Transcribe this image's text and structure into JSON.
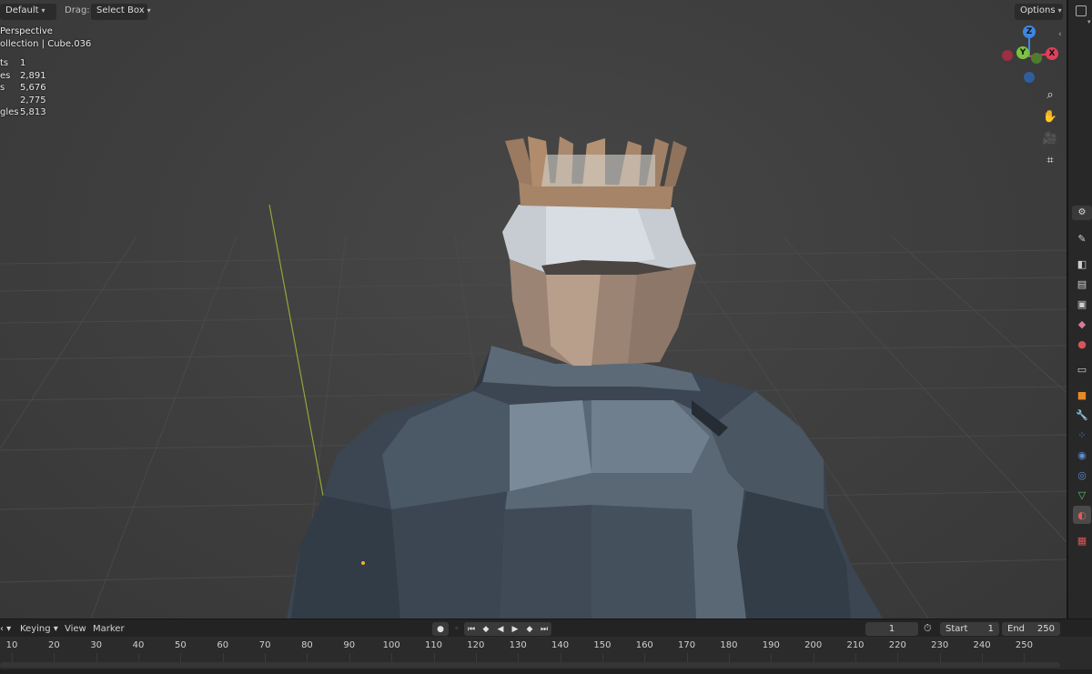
{
  "header": {
    "orientation_value": "Default",
    "drag_label": "Drag:",
    "drag_value": "Select Box",
    "options_label": "Options"
  },
  "overlay": {
    "view_name": "Perspective",
    "collection_line": "ollection | Cube.036"
  },
  "stats": [
    {
      "label": "ts",
      "value": "1"
    },
    {
      "label": "es",
      "value": "2,891"
    },
    {
      "label": "s",
      "value": "5,676"
    },
    {
      "label": "",
      "value": "2,775"
    },
    {
      "label": "gles",
      "value": "5,813"
    }
  ],
  "gizmo": {
    "z_label": "Z",
    "y_label": "Y",
    "x_label": "X",
    "colors": {
      "x": "#e0405a",
      "y": "#7cc242",
      "z": "#3f86e0"
    }
  },
  "nav_buttons": [
    "zoom-icon",
    "hand-pan-icon",
    "camera-icon",
    "grid-ortho-icon"
  ],
  "properties_tabs": [
    {
      "name": "tool-icon",
      "glyph": "✎",
      "color": "#cfcfcf"
    },
    {
      "name": "render-icon",
      "glyph": "◧",
      "color": "#cfcfcf"
    },
    {
      "name": "output-icon",
      "glyph": "▤",
      "color": "#cfcfcf"
    },
    {
      "name": "view-layer-icon",
      "glyph": "▣",
      "color": "#cfcfcf"
    },
    {
      "name": "scene-icon",
      "glyph": "◆",
      "color": "#d77aa0"
    },
    {
      "name": "world-icon",
      "glyph": "●",
      "color": "#d9545a"
    },
    {
      "name": "collection-icon",
      "glyph": "▭",
      "color": "#cfcfcf"
    },
    {
      "name": "object-icon",
      "glyph": "■",
      "color": "#e58a26"
    },
    {
      "name": "modifier-icon",
      "glyph": "🔧",
      "color": "#5b8fd6"
    },
    {
      "name": "particles-icon",
      "glyph": "⁘",
      "color": "#5b8fd6"
    },
    {
      "name": "physics-icon",
      "glyph": "◉",
      "color": "#5b8fd6"
    },
    {
      "name": "constraints-icon",
      "glyph": "◎",
      "color": "#5b8fd6"
    },
    {
      "name": "data-icon",
      "glyph": "▽",
      "color": "#5fc36d"
    },
    {
      "name": "material-icon",
      "glyph": "◐",
      "color": "#e05a5a"
    },
    {
      "name": "texture-icon",
      "glyph": "▦",
      "color": "#d9545a"
    }
  ],
  "timeline": {
    "menus": {
      "keying": "Keying",
      "view": "View",
      "marker": "Marker"
    },
    "current_frame": "1",
    "start_label": "Start",
    "start_value": "1",
    "end_label": "End",
    "end_value": "250",
    "ticks": [
      "10",
      "20",
      "30",
      "40",
      "50",
      "60",
      "70",
      "80",
      "90",
      "100",
      "110",
      "120",
      "130",
      "140",
      "150",
      "160",
      "170",
      "180",
      "190",
      "200",
      "210",
      "220",
      "230",
      "240",
      "250"
    ]
  }
}
